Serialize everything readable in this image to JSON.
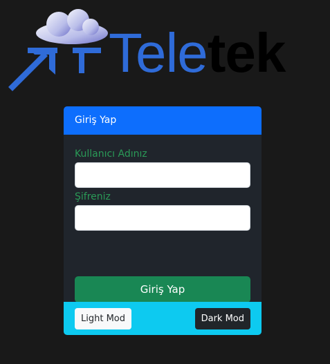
{
  "logo": {
    "brand_first": "Tele",
    "brand_second": "tek",
    "colors": {
      "blue": "#2f6bd8",
      "black": "#000000",
      "cloud": "#d7dbf2"
    }
  },
  "login": {
    "header_title": "Giriş Yap",
    "username_label": "Kullanıcı Adınız",
    "password_label": "Şifreniz",
    "username_value": "",
    "password_value": "",
    "submit_label": "Giriş Yap"
  },
  "theme": {
    "light_label": "Light Mod",
    "dark_label": "Dark Mod"
  },
  "colors": {
    "background": "#191919",
    "card": "#20252c",
    "header": "#0d6efd",
    "label": "#2a9a57",
    "submit": "#198754",
    "footer": "#0dcaf0"
  }
}
